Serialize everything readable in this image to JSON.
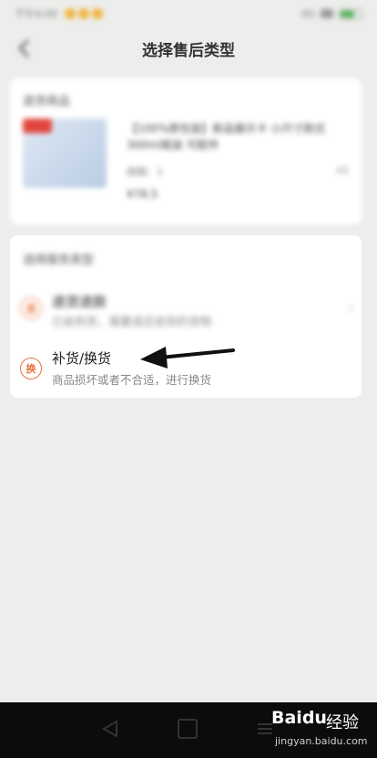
{
  "status_bar": {
    "time": "下午4:00",
    "signal_text": "4G"
  },
  "header": {
    "title": "选择售后类型",
    "back_icon": "chevron-left-icon"
  },
  "product_card": {
    "section_label": "退货商品",
    "title": "【100%原包装】新品展示卡 小尺寸款式300ml瓶装 可配件",
    "spec": "规格：1",
    "price": "¥78.5",
    "quantity": "x1"
  },
  "service_card": {
    "section_label": "选择服务类型",
    "options": [
      {
        "title": "退货退款",
        "desc": "已收到货，需要退还收到的货物",
        "icon_glyph": "退",
        "icon": "return-icon"
      },
      {
        "title": "补货/换货",
        "desc": "商品损坏或者不合适，进行换货",
        "icon_glyph": "换",
        "icon": "exchange-icon"
      }
    ]
  },
  "watermark": {
    "logo": "Baidu",
    "cn_text": "经验",
    "url": "jingyan.baidu.com"
  },
  "colors": {
    "accent": "#e8743e",
    "background": "#eceeec",
    "nav_bar": "#0c0c0c"
  }
}
